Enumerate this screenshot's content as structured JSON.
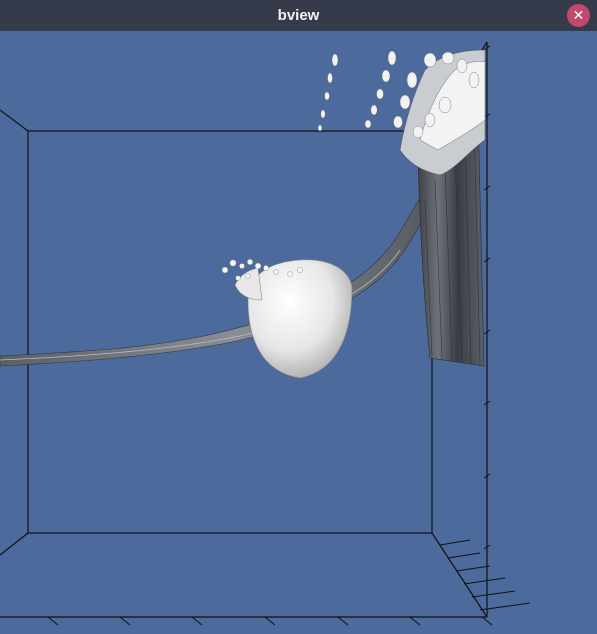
{
  "window": {
    "title": "bview",
    "close_glyph": "✕",
    "close_icon": "close-icon"
  },
  "colors": {
    "titlebar_bg": "#353b4a",
    "viewport_bg": "#4d6a9c",
    "close_bg": "#c2496e",
    "surface": "#ececec",
    "surface_shadow": "#9a9a9a",
    "frame": "#111111"
  }
}
